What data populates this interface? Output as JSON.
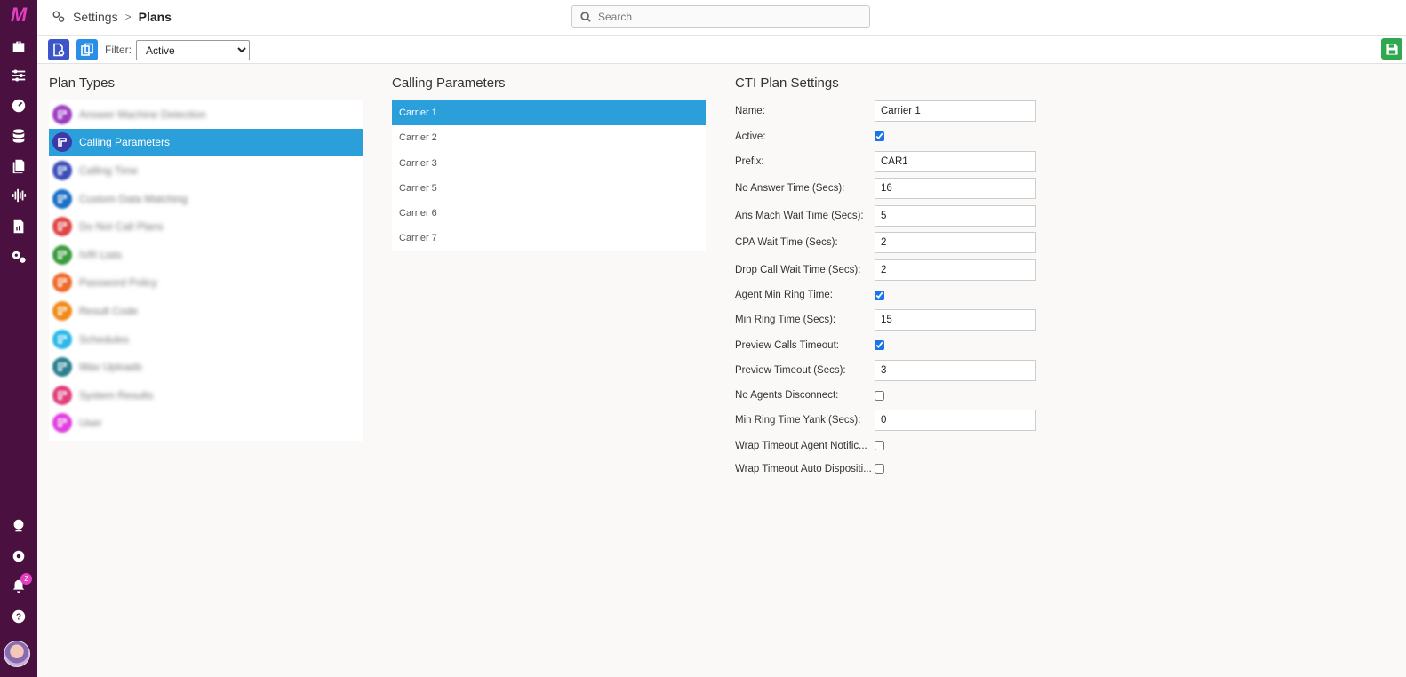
{
  "rail": {
    "logo": "M",
    "notification_count": "2"
  },
  "header": {
    "breadcrumb_root": "Settings",
    "breadcrumb_sep": ">",
    "breadcrumb_current": "Plans",
    "search_placeholder": "Search"
  },
  "toolbar": {
    "filter_label": "Filter:",
    "filter_value": "Active",
    "filter_options": [
      "Active"
    ]
  },
  "plan_types": {
    "title": "Plan Types",
    "items": [
      {
        "label": "Answer Machine Detection",
        "color": "#9c3dbf",
        "blurred": true
      },
      {
        "label": "Calling Parameters",
        "color": "#3b3aa8",
        "blurred": false,
        "selected": true
      },
      {
        "label": "Calling Time",
        "color": "#3a4fb8",
        "blurred": true
      },
      {
        "label": "Custom Data Matching",
        "color": "#1a6fc6",
        "blurred": true
      },
      {
        "label": "Do Not Call Plans",
        "color": "#e04545",
        "blurred": true
      },
      {
        "label": "IVR Lists",
        "color": "#3a9a3e",
        "blurred": true
      },
      {
        "label": "Password Policy",
        "color": "#f06a2a",
        "blurred": true
      },
      {
        "label": "Result Code",
        "color": "#f08a1a",
        "blurred": true
      },
      {
        "label": "Schedules",
        "color": "#2bb8e8",
        "blurred": true
      },
      {
        "label": "Wav Uploads",
        "color": "#2a7f8f",
        "blurred": true
      },
      {
        "label": "System Results",
        "color": "#e0407a",
        "blurred": true
      },
      {
        "label": "User",
        "color": "#e040e0",
        "blurred": true
      }
    ]
  },
  "calling_parameters": {
    "title": "Calling Parameters",
    "carriers": [
      "Carrier 1",
      "Carrier 2",
      "Carrier 3",
      "Carrier 5",
      "Carrier 6",
      "Carrier 7"
    ],
    "selected": "Carrier 1"
  },
  "cti": {
    "title": "CTI Plan Settings",
    "fields": [
      {
        "label": "Name:",
        "type": "text",
        "value": "Carrier 1"
      },
      {
        "label": "Active:",
        "type": "check",
        "checked": true
      },
      {
        "label": "Prefix:",
        "type": "text",
        "value": "CAR1"
      },
      {
        "label": "No Answer Time (Secs):",
        "type": "text",
        "value": "16"
      },
      {
        "label": "Ans Mach Wait Time (Secs):",
        "type": "text",
        "value": "5"
      },
      {
        "label": "CPA Wait Time (Secs):",
        "type": "text",
        "value": "2"
      },
      {
        "label": "Drop Call Wait Time (Secs):",
        "type": "text",
        "value": "2"
      },
      {
        "label": "Agent Min Ring Time:",
        "type": "check",
        "checked": true
      },
      {
        "label": "Min Ring Time (Secs):",
        "type": "text",
        "value": "15"
      },
      {
        "label": "Preview Calls Timeout:",
        "type": "check",
        "checked": true
      },
      {
        "label": "Preview Timeout (Secs):",
        "type": "text",
        "value": "3"
      },
      {
        "label": "No Agents Disconnect:",
        "type": "check",
        "checked": false
      },
      {
        "label": "Min Ring Time Yank (Secs):",
        "type": "text",
        "value": "0"
      },
      {
        "label": "Wrap Timeout Agent Notific...",
        "type": "check",
        "checked": false
      },
      {
        "label": "Wrap Timeout Auto Dispositi...",
        "type": "check",
        "checked": false
      }
    ]
  },
  "colors": {
    "rail_bg": "#4a1140",
    "accent_blue": "#2a9fd9",
    "brand_pink": "#e23ec0",
    "save_green": "#2fa84f"
  }
}
